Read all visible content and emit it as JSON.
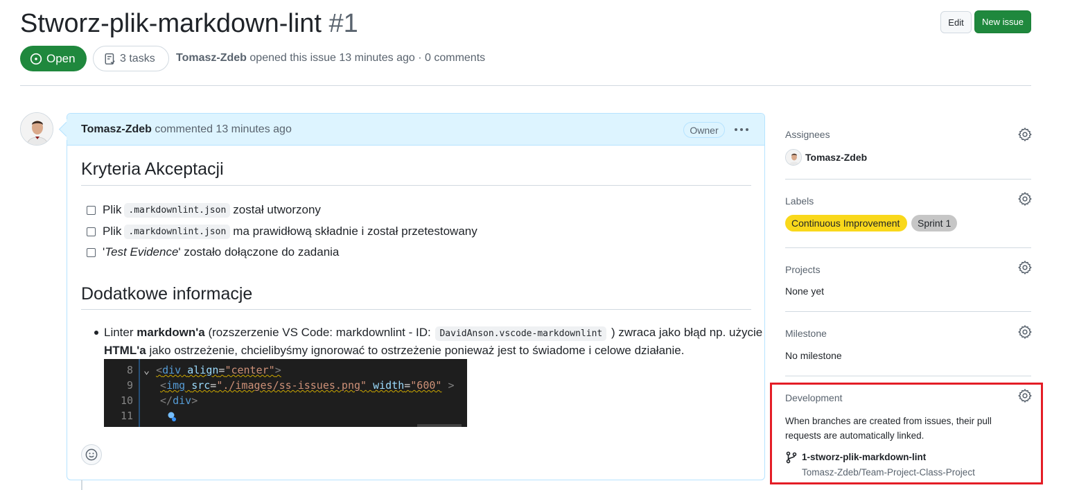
{
  "issue": {
    "title": "Stworz-plik-markdown-lint",
    "number": "#1",
    "state": "Open",
    "tasks": "3 tasks",
    "author": "Tomasz-Zdeb",
    "opened_text": "opened this issue 13 minutes ago · 0 comments"
  },
  "header_actions": {
    "edit": "Edit",
    "new_issue": "New issue"
  },
  "comment": {
    "author": "Tomasz-Zdeb",
    "meta": "commented 13 minutes ago",
    "role_badge": "Owner",
    "more_icon": "kebab-horizontal-icon",
    "heading_criteria": "Kryteria Akceptacji",
    "tasks": [
      {
        "before": "Plik",
        "code": ".markdownlint.json",
        "after": "został utworzony",
        "checked": false
      },
      {
        "before": "Plik",
        "code": ".markdownlint.json",
        "after": "ma prawidłową składnie i został przetestowany",
        "checked": false
      },
      {
        "before": "'",
        "italic": "Test Evidence",
        "after": "' zostało dołączone do zadania",
        "checked": false
      }
    ],
    "heading_additional": "Dodatkowe informacje",
    "bullet": {
      "p1": "Linter ",
      "b1": "markdown'a",
      "p2": " (rozszerzenie VS Code: markdownlint - ID: ",
      "code": "DavidAnson.vscode-markdownlint",
      "p3": " ) zwraca jako błąd np. użycie",
      "b2": "HTML'a",
      "p4": " jako ostrzeżenie, chcielibyśmy ignorować to ostrzeżenie ponieważ jest to świadome i celowe działanie."
    },
    "code_screenshot": {
      "lines": [
        {
          "n": "8",
          "open": "<",
          "tag": "div",
          "attr": "align",
          "eq": "=",
          "val": "\"center\"",
          "close": ">"
        },
        {
          "n": "9",
          "open": "<",
          "tag": "img",
          "attr": "src",
          "eq": "=",
          "val": "\"./images/ss-issues.png\"",
          "attr2": "width",
          "val2": "\"600\"",
          "close": " >"
        },
        {
          "n": "10",
          "open": "</",
          "tag": "div",
          "close": ">"
        },
        {
          "n": "11"
        }
      ]
    }
  },
  "sidebar": {
    "assignees": {
      "heading": "Assignees",
      "name": "Tomasz-Zdeb"
    },
    "labels": {
      "heading": "Labels",
      "items": [
        {
          "name": "Continuous Improvement",
          "color": "#f9d81b"
        },
        {
          "name": "Sprint 1",
          "color": "#c6c6c6"
        }
      ]
    },
    "projects": {
      "heading": "Projects",
      "value": "None yet"
    },
    "milestone": {
      "heading": "Milestone",
      "value": "No milestone"
    },
    "development": {
      "heading": "Development",
      "description": "When branches are created from issues, their pull requests are automatically linked.",
      "branch": "1-stworz-plik-markdown-lint",
      "repo": "Tomasz-Zdeb/Team-Project-Class-Project",
      "highlight_color": "#e41d26"
    }
  },
  "colors": {
    "open_green": "#1f883d",
    "comment_header": "#ddf4ff",
    "label_yellow": "#f9d81b"
  }
}
